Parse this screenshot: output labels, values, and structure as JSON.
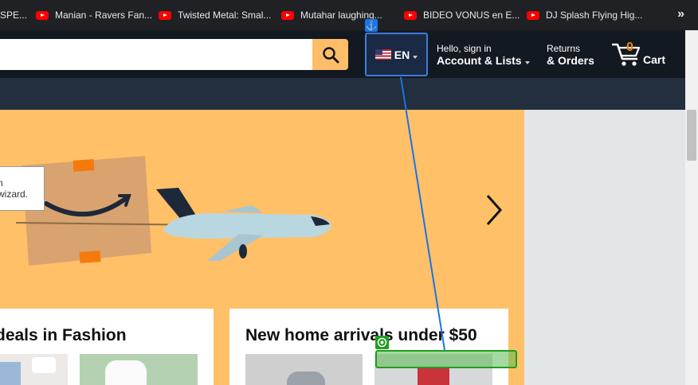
{
  "bookmarks": {
    "items": [
      {
        "label": "SPE...",
        "icon": "none"
      },
      {
        "label": "Manian - Ravers Fan...",
        "icon": "youtube-icon"
      },
      {
        "label": "Twisted Metal: Smal...",
        "icon": "youtube-icon"
      },
      {
        "label": "Mutahar laughing...",
        "icon": "youtube-icon"
      },
      {
        "label": "BIDEO VONUS en E...",
        "icon": "youtube-icon"
      },
      {
        "label": "DJ Splash Flying Hig...",
        "icon": "youtube-icon"
      }
    ],
    "more_label": "»"
  },
  "header": {
    "search_value": "",
    "language": "EN",
    "account_line1": "Hello, sign in",
    "account_line2": "Account & Lists",
    "returns_line1": "Returns",
    "returns_line2": "& Orders",
    "cart_count": "0",
    "cart_label": "Cart"
  },
  "hero": {
    "tooltip_text": "n wizard."
  },
  "cards": [
    {
      "title": "deals in Fashion"
    },
    {
      "title": "New home arrivals under $50"
    }
  ],
  "overlay": {
    "anchor_icon": "anchor-icon",
    "target_icon": "target-icon"
  },
  "colors": {
    "header_bg": "#131921",
    "subnav_bg": "#232f3e",
    "search_button": "#febd69",
    "hero_bg": "#ffc067",
    "cart_count": "#f08804",
    "overlay_blue": "#3b7ddd",
    "overlay_green": "#1f9e1f"
  }
}
